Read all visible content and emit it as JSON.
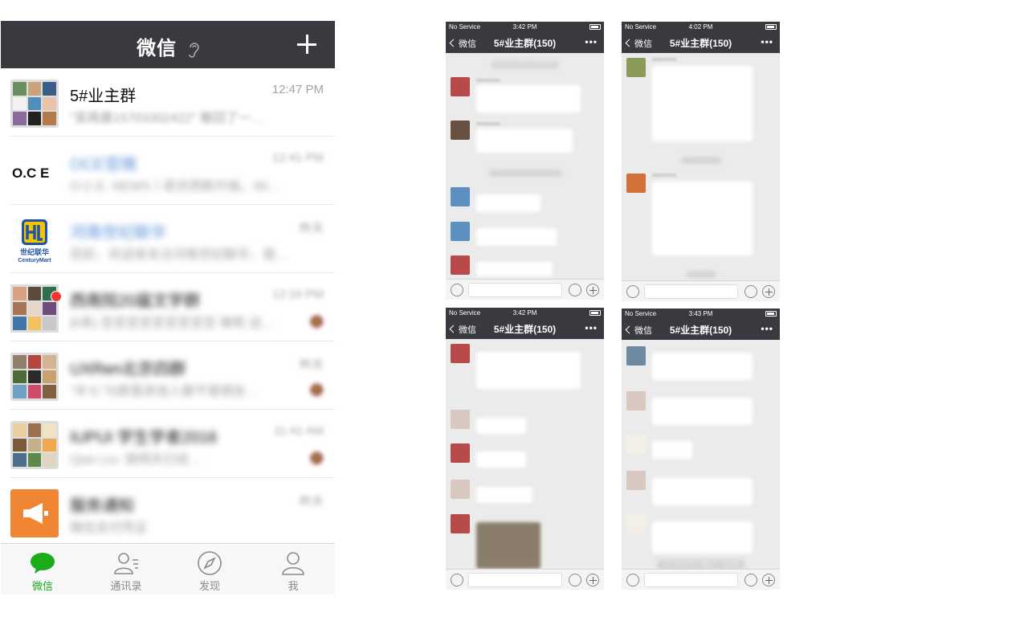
{
  "main": {
    "title": "微信",
    "add_icon": "plus-icon",
    "chats": [
      {
        "name": "5#业主群",
        "time": "12:47 PM",
        "preview": "\"吴雨晨15703302422\" 撤回了一…",
        "avatar": "group-avatar"
      },
      {
        "name": "OCE官微",
        "time": "12:41 PM",
        "preview": "O.C.E. NEWS丨若衣而新升级，60…",
        "avatar": "oce-logo"
      },
      {
        "name": "河南世纪联华",
        "time": "昨天",
        "preview": "您好，欢迎来关注河南世纪联华，我…",
        "avatar": "centurymart-logo",
        "logo_cn": "世纪联华",
        "logo_en": "CenturyMart"
      },
      {
        "name": "西南院20届文学群",
        "time": "12:16 PM",
        "preview": "[6条] 至至至至至至至至至 哪呢 这…",
        "avatar": "group-avatar",
        "unread_dot": true
      },
      {
        "name": "UXRen北京四群",
        "time": "昨天",
        "preview": "\"丰七\"与群里其他人都不是朋友…",
        "avatar": "group-avatar"
      },
      {
        "name": "IUPUI 学生学者2016",
        "time": "11:41 AM",
        "preview": "Qian Liu: 我明天已经…",
        "avatar": "group-avatar"
      },
      {
        "name": "服务通知",
        "time": "昨天",
        "preview": "微信支付凭证",
        "avatar": "megaphone-icon"
      }
    ],
    "tabs": [
      {
        "label": "微信",
        "icon": "chat-bubble-icon",
        "active": true
      },
      {
        "label": "通讯录",
        "icon": "contacts-icon",
        "active": false
      },
      {
        "label": "发现",
        "icon": "compass-icon",
        "active": false
      },
      {
        "label": "我",
        "icon": "person-icon",
        "active": false
      }
    ]
  },
  "screens": [
    {
      "status_left": "No Service",
      "time": "3:42 PM",
      "back": "微信",
      "title": "5#业主群(150)",
      "tip": "Jun 24, 2018 12:34 PM"
    },
    {
      "status_left": "No Service",
      "time": "4:02 PM",
      "back": "微信",
      "title": "5#业主群(150)",
      "tip": ""
    },
    {
      "status_left": "No Service",
      "time": "3:42 PM",
      "back": "微信",
      "title": "5#业主群(150)",
      "tip": ""
    },
    {
      "status_left": "No Service",
      "time": "3:43 PM",
      "back": "微信",
      "title": "5#业主群(150)",
      "tip": "\"15703302422\" 撤回了一条消息"
    }
  ],
  "colors": {
    "header_bg": "#393a3f",
    "accent_green": "#1aad19",
    "unread_red": "#f43530",
    "service_orange": "#f08533"
  }
}
